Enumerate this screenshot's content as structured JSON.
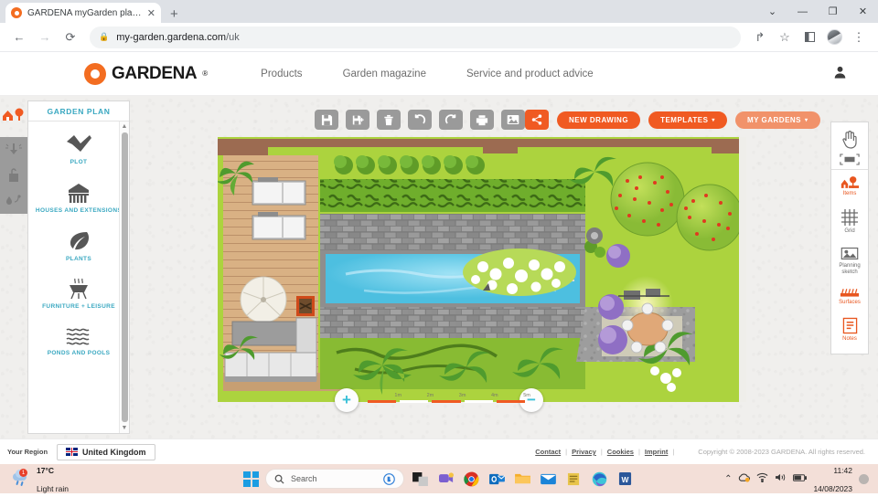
{
  "browser": {
    "tab": {
      "title": "GARDENA myGarden planner",
      "favicon": "gardena-icon",
      "close": "✕"
    },
    "new_tab": "+",
    "window_controls": {
      "dropdown": "⌄",
      "minimize": "—",
      "maximize": "❐",
      "close": "✕"
    },
    "nav": {
      "back": "←",
      "forward": "→",
      "reload": "⟳"
    },
    "omnibox": {
      "lock": "🔒",
      "host": "my-garden.gardena.com",
      "path": "/uk"
    },
    "actions": {
      "share": "↱",
      "bookmark": "☆",
      "sidebar": "▣",
      "menu": "⋮"
    }
  },
  "site": {
    "logo_text": "GARDENA",
    "logo_reg": "®",
    "nav": [
      "Products",
      "Garden magazine",
      "Service and product advice"
    ],
    "user_icon": "person-icon"
  },
  "app": {
    "rail": {
      "top_icon": "garden-plan-icon",
      "tools": [
        "sprinkler-icon",
        "water-tap-icon",
        "drip-irrigation-icon"
      ]
    },
    "panel": {
      "title": "GARDEN PLAN",
      "categories": [
        {
          "label": "PLOT",
          "icon": "plot-icon"
        },
        {
          "label": "HOUSES AND EXTENSIONS",
          "icon": "house-icon"
        },
        {
          "label": "PLANTS",
          "icon": "leaf-icon"
        },
        {
          "label": "FURNITURE + LEISURE",
          "icon": "grill-icon"
        },
        {
          "label": "PONDS AND POOLS",
          "icon": "waves-icon"
        }
      ],
      "scroll_up": "▲",
      "scroll_down": "▼"
    },
    "toolbar": {
      "buttons": [
        {
          "name": "save",
          "icon": "save-icon"
        },
        {
          "name": "save-as",
          "icon": "save-as-icon"
        },
        {
          "name": "delete",
          "icon": "trash-icon"
        },
        {
          "name": "undo",
          "icon": "undo-icon"
        },
        {
          "name": "redo",
          "icon": "redo-icon"
        },
        {
          "name": "print",
          "icon": "print-icon"
        },
        {
          "name": "image",
          "icon": "image-icon"
        }
      ],
      "share_icon": "share-icon",
      "new_drawing": "NEW DRAWING",
      "templates": "TEMPLATES",
      "my_gardens": "MY GARDENS",
      "caret": "▾"
    },
    "right_rail": {
      "hand": "hand-icon",
      "select": "select-icon",
      "items": [
        {
          "label": "Items",
          "icon": "items-icon",
          "active": true
        },
        {
          "label": "Grid",
          "icon": "grid-icon",
          "active": false
        },
        {
          "label": "Planning sketch",
          "icon": "sketch-icon",
          "active": false
        },
        {
          "label": "Surfaces",
          "icon": "surfaces-icon",
          "active": true
        },
        {
          "label": "Notes",
          "icon": "notes-icon",
          "active": true
        }
      ]
    },
    "zoom": {
      "in": "+",
      "out": "−"
    },
    "scale_ticks": [
      "1m",
      "2m",
      "3m",
      "4m",
      "5m"
    ]
  },
  "footer": {
    "region_label": "Your Region",
    "region_name": "United Kingdom",
    "links": [
      "Contact",
      "Privacy",
      "Cookies",
      "Imprint"
    ],
    "separator": "|",
    "copyright": "Copyright © 2008-2023 GARDENA. All rights reserved."
  },
  "taskbar": {
    "weather": {
      "temp": "17°C",
      "condition": "Light rain",
      "badge": "1"
    },
    "start": "windows-icon",
    "search_placeholder": "Search",
    "search_icon": "search-icon",
    "apps": [
      "copilot-icon",
      "taskview-icon",
      "teams-icon",
      "chrome-icon",
      "outlook-icon",
      "explorer-icon",
      "mail-icon",
      "notes-icon",
      "edge-icon",
      "word-icon"
    ],
    "system": {
      "chevron": "⌃",
      "onedrive": "↻",
      "wifi": "◠",
      "volume": "🔊",
      "battery": "▬"
    },
    "clock": {
      "time": "11:42",
      "date": "14/08/2023"
    }
  },
  "colors": {
    "brand_orange": "#f05a22",
    "teal": "#3aa8c1",
    "grass": "#a8cf38"
  }
}
